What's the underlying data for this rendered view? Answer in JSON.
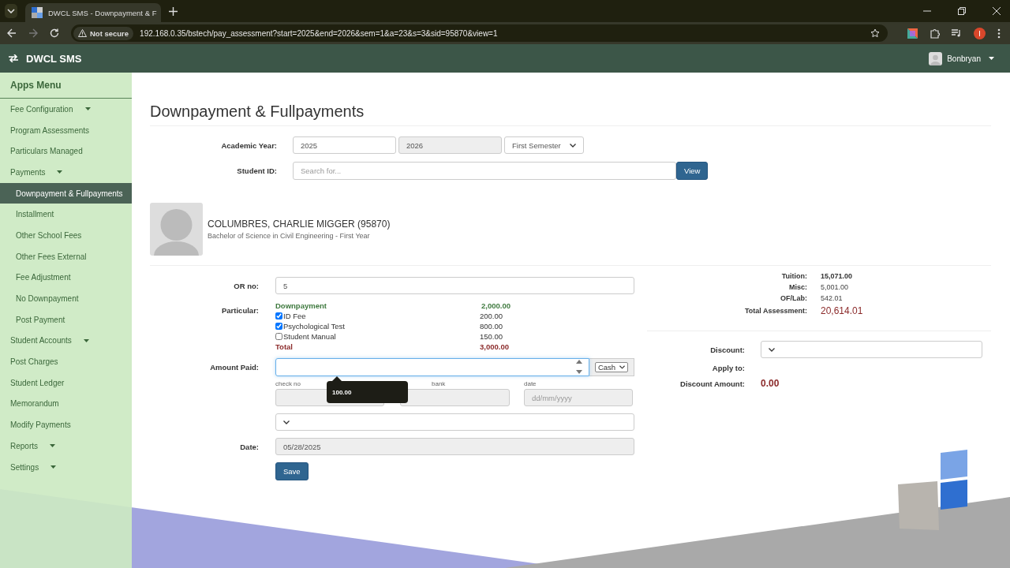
{
  "browser": {
    "tab_title": "DWCL SMS - Downpayment & F",
    "security": "Not secure",
    "url": "192.168.0.35/bstech/pay_assessment?start=2025&end=2026&sem=1&a=23&s=3&sid=95870&view=1"
  },
  "navbar": {
    "brand": "DWCL SMS",
    "user": "Bonbryan"
  },
  "sidebar": {
    "title": "Apps Menu",
    "items": [
      {
        "label": "Fee Configuration",
        "expandable": true,
        "selected": false
      },
      {
        "label": "Program Assessments",
        "expandable": false,
        "selected": false
      },
      {
        "label": "Particulars Managed",
        "expandable": false,
        "selected": false
      },
      {
        "label": "Payments",
        "expandable": true,
        "selected": false,
        "children": [
          {
            "label": "Downpayment & Fullpayments",
            "selected": true
          },
          {
            "label": "Installment",
            "selected": false
          },
          {
            "label": "Other School Fees",
            "selected": false
          },
          {
            "label": "Other Fees External",
            "selected": false
          },
          {
            "label": "Fee Adjustment",
            "selected": false
          },
          {
            "label": "No Downpayment",
            "selected": false
          },
          {
            "label": "Post Payment",
            "selected": false
          }
        ]
      },
      {
        "label": "Student Accounts",
        "expandable": true,
        "selected": false
      },
      {
        "label": "Post Charges",
        "expandable": false,
        "selected": false
      },
      {
        "label": "Student Ledger",
        "expandable": false,
        "selected": false
      },
      {
        "label": "Memorandum",
        "expandable": false,
        "selected": false
      },
      {
        "label": "Modify Payments",
        "expandable": false,
        "selected": false
      },
      {
        "label": "Reports",
        "expandable": true,
        "selected": false
      },
      {
        "label": "Settings",
        "expandable": true,
        "selected": false
      }
    ]
  },
  "page": {
    "title": "Downpayment & Fullpayments",
    "academic_year": {
      "label": "Academic Year:",
      "start": "2025",
      "end": "2026",
      "semester": "First Semester"
    },
    "student_id": {
      "label": "Student ID:",
      "placeholder": "Search for...",
      "button": "View"
    },
    "student": {
      "name": "COLUMBRES, CHARLIE MIGGER (95870)",
      "program": "Bachelor of Science in Civil Engineering - First Year"
    },
    "or_no": {
      "label": "OR no:",
      "value": "5"
    },
    "particular": {
      "label": "Particular:",
      "downpayment_label": "Downpayment",
      "downpayment_amount": "2,000.00",
      "items": [
        {
          "label": "ID Fee",
          "amount": "200.00",
          "checked": true
        },
        {
          "label": "Psychological Test",
          "amount": "800.00",
          "checked": true
        },
        {
          "label": "Student Manual",
          "amount": "150.00",
          "checked": false
        }
      ],
      "total_label": "Total",
      "total_amount": "3,000.00"
    },
    "amount_paid": {
      "label": "Amount Paid:",
      "method": "Cash",
      "tooltip": "100.00"
    },
    "check_no": {
      "label": "check no"
    },
    "bank": {
      "label": "bank"
    },
    "check_date": {
      "label": "date",
      "placeholder": "dd/mm/yyyy"
    },
    "date": {
      "label": "Date:",
      "value": "05/28/2025"
    },
    "save_button": "Save",
    "summary": [
      {
        "label": "Tuition:",
        "value": "15,071.00",
        "kind": "bold"
      },
      {
        "label": "Misc:",
        "value": "5,001.00",
        "kind": "plain"
      },
      {
        "label": "OF/Lab:",
        "value": "542.01",
        "kind": "plain"
      },
      {
        "label": "Total Assessment:",
        "value": "20,614.01",
        "kind": "total"
      }
    ],
    "discount": {
      "label": "Discount:",
      "apply_label": "Apply to:",
      "amount_label": "Discount Amount:",
      "amount": "0.00"
    }
  }
}
